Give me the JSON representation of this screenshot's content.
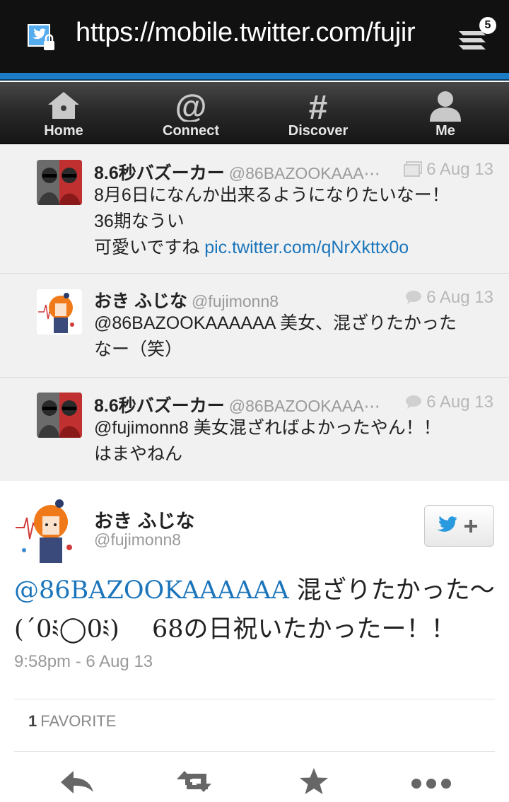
{
  "browser": {
    "url": "https://mobile.twitter.com/fujir",
    "tab_count": "5"
  },
  "nav": {
    "items": [
      {
        "label": "Home"
      },
      {
        "label": "Connect"
      },
      {
        "label": "Discover"
      },
      {
        "label": "Me"
      }
    ]
  },
  "conversation": [
    {
      "name": "8.6秒バズーカー",
      "handle": "@86BAZOOKAAA⋯",
      "date": "6 Aug 13",
      "lines": [
        "8月6日になんか出来るようになりたいなー！",
        "36期なうい"
      ],
      "last_line_text": "可愛いですね ",
      "link": "pic.twitter.com/qNrXkttx0o"
    },
    {
      "name": "おき ふじな",
      "handle": "@fujimonn8",
      "date": "6 Aug 13",
      "lines": [
        "@86BAZOOKAAAAAA 美女、混ざりたかった",
        "なー（笑）"
      ]
    },
    {
      "name": "8.6秒バズーカー",
      "handle": "@86BAZOOKAAA⋯",
      "date": "6 Aug 13",
      "lines": [
        "@fujimonn8 美女混ざればよかったやん！！",
        "はまやねん"
      ]
    }
  ],
  "main_tweet": {
    "name": "おき ふじな",
    "handle": "@fujimonn8",
    "mention": "@86BAZOOKAAAAAA",
    "line1_rest": " 混ざりたかった〜",
    "line2": "(´0༴◯0༴)　 68の日祝いたかったー！！",
    "timestamp": "9:58pm - 6 Aug 13",
    "favorite_count": "1",
    "favorite_label": "FAVORITE"
  }
}
